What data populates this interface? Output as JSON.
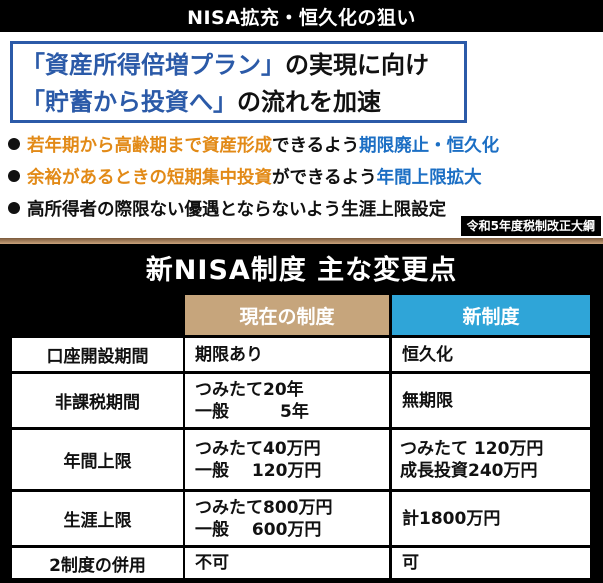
{
  "top": {
    "banner": "NISA拡充・恒久化の狙い",
    "goal_line1_hl": "「資産所得倍増プラン」",
    "goal_line1_rest": "の実現に向け",
    "goal_line2_hl": "「貯蓄から投資へ」",
    "goal_line2_rest": "の流れを加速",
    "bullet1_a": "若年期から高齢期まで資産形成",
    "bullet1_b": "できるよう",
    "bullet1_c": "期限廃止・恒久化",
    "bullet2_a": "余裕があるときの短期集中投資",
    "bullet2_b": "ができるよう",
    "bullet2_c": "年間上限拡大",
    "bullet3": "高所得者の際限ない優遇とならないよう生涯上限設定",
    "source": "令和5年度税制改正大綱",
    "colors": {
      "goal_blue": "#2b5aa8",
      "orange": "#e28a17",
      "blue": "#1c6fc4"
    }
  },
  "table": {
    "title": "新NISA制度 主な変更点",
    "header_current": "現在の制度",
    "header_new": "新制度",
    "rows": [
      {
        "label": "口座開設期間",
        "current_l1": "期限あり",
        "new_l1": "恒久化"
      },
      {
        "label": "非課税期間",
        "current_l1": "つみたて20年",
        "current_l2": "一般　　　5年",
        "new_l1": "無期限"
      },
      {
        "label": "年間上限",
        "current_l1": "つみたて40万円",
        "current_l2": "一般　 120万円",
        "new_l1": "つみたて 120万円",
        "new_l2": "成長投資240万円"
      },
      {
        "label": "生涯上限",
        "current_l1": "つみたて800万円",
        "current_l2": "一般　 600万円",
        "new_l1": "計1800万円"
      },
      {
        "label": "2制度の併用",
        "current_l1": "不可",
        "new_l1": "可"
      }
    ],
    "colors": {
      "header_current": "#c6a57c",
      "header_new": "#2fa5d8"
    }
  }
}
